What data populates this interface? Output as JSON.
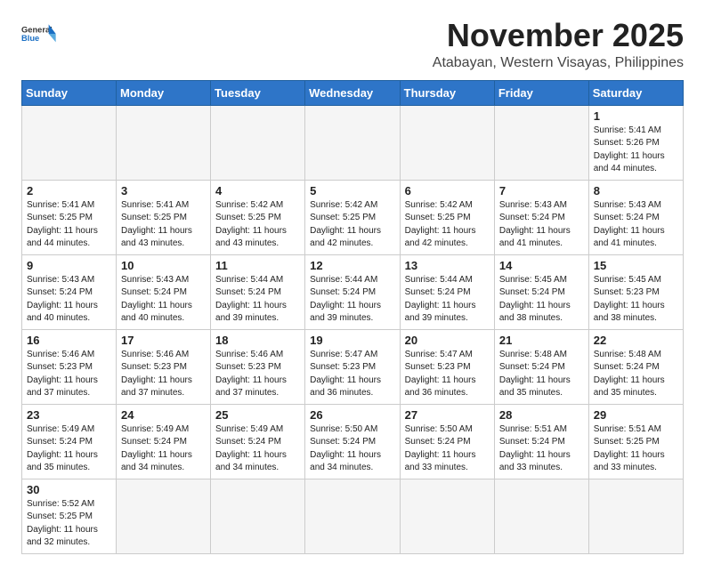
{
  "header": {
    "logo_line1": "General",
    "logo_line2": "Blue",
    "month": "November 2025",
    "location": "Atabayan, Western Visayas, Philippines"
  },
  "weekdays": [
    "Sunday",
    "Monday",
    "Tuesday",
    "Wednesday",
    "Thursday",
    "Friday",
    "Saturday"
  ],
  "weeks": [
    [
      {
        "day": "",
        "info": ""
      },
      {
        "day": "",
        "info": ""
      },
      {
        "day": "",
        "info": ""
      },
      {
        "day": "",
        "info": ""
      },
      {
        "day": "",
        "info": ""
      },
      {
        "day": "",
        "info": ""
      },
      {
        "day": "1",
        "info": "Sunrise: 5:41 AM\nSunset: 5:26 PM\nDaylight: 11 hours\nand 44 minutes."
      }
    ],
    [
      {
        "day": "2",
        "info": "Sunrise: 5:41 AM\nSunset: 5:25 PM\nDaylight: 11 hours\nand 44 minutes."
      },
      {
        "day": "3",
        "info": "Sunrise: 5:41 AM\nSunset: 5:25 PM\nDaylight: 11 hours\nand 43 minutes."
      },
      {
        "day": "4",
        "info": "Sunrise: 5:42 AM\nSunset: 5:25 PM\nDaylight: 11 hours\nand 43 minutes."
      },
      {
        "day": "5",
        "info": "Sunrise: 5:42 AM\nSunset: 5:25 PM\nDaylight: 11 hours\nand 42 minutes."
      },
      {
        "day": "6",
        "info": "Sunrise: 5:42 AM\nSunset: 5:25 PM\nDaylight: 11 hours\nand 42 minutes."
      },
      {
        "day": "7",
        "info": "Sunrise: 5:43 AM\nSunset: 5:24 PM\nDaylight: 11 hours\nand 41 minutes."
      },
      {
        "day": "8",
        "info": "Sunrise: 5:43 AM\nSunset: 5:24 PM\nDaylight: 11 hours\nand 41 minutes."
      }
    ],
    [
      {
        "day": "9",
        "info": "Sunrise: 5:43 AM\nSunset: 5:24 PM\nDaylight: 11 hours\nand 40 minutes."
      },
      {
        "day": "10",
        "info": "Sunrise: 5:43 AM\nSunset: 5:24 PM\nDaylight: 11 hours\nand 40 minutes."
      },
      {
        "day": "11",
        "info": "Sunrise: 5:44 AM\nSunset: 5:24 PM\nDaylight: 11 hours\nand 39 minutes."
      },
      {
        "day": "12",
        "info": "Sunrise: 5:44 AM\nSunset: 5:24 PM\nDaylight: 11 hours\nand 39 minutes."
      },
      {
        "day": "13",
        "info": "Sunrise: 5:44 AM\nSunset: 5:24 PM\nDaylight: 11 hours\nand 39 minutes."
      },
      {
        "day": "14",
        "info": "Sunrise: 5:45 AM\nSunset: 5:24 PM\nDaylight: 11 hours\nand 38 minutes."
      },
      {
        "day": "15",
        "info": "Sunrise: 5:45 AM\nSunset: 5:23 PM\nDaylight: 11 hours\nand 38 minutes."
      }
    ],
    [
      {
        "day": "16",
        "info": "Sunrise: 5:46 AM\nSunset: 5:23 PM\nDaylight: 11 hours\nand 37 minutes."
      },
      {
        "day": "17",
        "info": "Sunrise: 5:46 AM\nSunset: 5:23 PM\nDaylight: 11 hours\nand 37 minutes."
      },
      {
        "day": "18",
        "info": "Sunrise: 5:46 AM\nSunset: 5:23 PM\nDaylight: 11 hours\nand 37 minutes."
      },
      {
        "day": "19",
        "info": "Sunrise: 5:47 AM\nSunset: 5:23 PM\nDaylight: 11 hours\nand 36 minutes."
      },
      {
        "day": "20",
        "info": "Sunrise: 5:47 AM\nSunset: 5:23 PM\nDaylight: 11 hours\nand 36 minutes."
      },
      {
        "day": "21",
        "info": "Sunrise: 5:48 AM\nSunset: 5:24 PM\nDaylight: 11 hours\nand 35 minutes."
      },
      {
        "day": "22",
        "info": "Sunrise: 5:48 AM\nSunset: 5:24 PM\nDaylight: 11 hours\nand 35 minutes."
      }
    ],
    [
      {
        "day": "23",
        "info": "Sunrise: 5:49 AM\nSunset: 5:24 PM\nDaylight: 11 hours\nand 35 minutes."
      },
      {
        "day": "24",
        "info": "Sunrise: 5:49 AM\nSunset: 5:24 PM\nDaylight: 11 hours\nand 34 minutes."
      },
      {
        "day": "25",
        "info": "Sunrise: 5:49 AM\nSunset: 5:24 PM\nDaylight: 11 hours\nand 34 minutes."
      },
      {
        "day": "26",
        "info": "Sunrise: 5:50 AM\nSunset: 5:24 PM\nDaylight: 11 hours\nand 34 minutes."
      },
      {
        "day": "27",
        "info": "Sunrise: 5:50 AM\nSunset: 5:24 PM\nDaylight: 11 hours\nand 33 minutes."
      },
      {
        "day": "28",
        "info": "Sunrise: 5:51 AM\nSunset: 5:24 PM\nDaylight: 11 hours\nand 33 minutes."
      },
      {
        "day": "29",
        "info": "Sunrise: 5:51 AM\nSunset: 5:25 PM\nDaylight: 11 hours\nand 33 minutes."
      }
    ],
    [
      {
        "day": "30",
        "info": "Sunrise: 5:52 AM\nSunset: 5:25 PM\nDaylight: 11 hours\nand 32 minutes."
      },
      {
        "day": "",
        "info": ""
      },
      {
        "day": "",
        "info": ""
      },
      {
        "day": "",
        "info": ""
      },
      {
        "day": "",
        "info": ""
      },
      {
        "day": "",
        "info": ""
      },
      {
        "day": "",
        "info": ""
      }
    ]
  ]
}
